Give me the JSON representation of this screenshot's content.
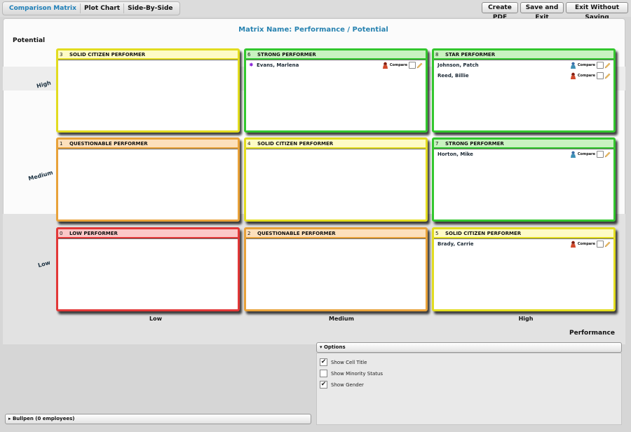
{
  "tabs": [
    "Comparison Matrix",
    "Plot Chart",
    "Side-By-Side"
  ],
  "toolbar": {
    "create_pdf": "Create PDF",
    "save_exit": "Save and Exit",
    "exit_no_save": "Exit Without Saving"
  },
  "matrix_name": "Matrix Name: Performance / Potential",
  "axis": {
    "y_title": "Potential",
    "x_title": "Performance",
    "rows": [
      "High",
      "Medium",
      "Low"
    ],
    "cols": [
      "Low",
      "Medium",
      "High"
    ]
  },
  "cells": [
    {
      "num": "3",
      "title": "SOLID CITIZEN PERFORMER",
      "employees": []
    },
    {
      "num": "6",
      "title": "STRONG PERFORMER",
      "employees": [
        {
          "name": "Evans, Marlena",
          "gender": "female",
          "bullet": "✸"
        }
      ]
    },
    {
      "num": "8",
      "title": "STAR PERFORMER",
      "employees": [
        {
          "name": "Johnson, Patch",
          "gender": "male"
        },
        {
          "name": "Reed, Billie",
          "gender": "female"
        }
      ]
    },
    {
      "num": "1",
      "title": "QUESTIONABLE PERFORMER",
      "employees": []
    },
    {
      "num": "4",
      "title": "SOLID CITIZEN PERFORMER",
      "employees": []
    },
    {
      "num": "7",
      "title": "STRONG PERFORMER",
      "employees": [
        {
          "name": "Horton, Mike",
          "gender": "male"
        }
      ]
    },
    {
      "num": "0",
      "title": "LOW PERFORMER",
      "employees": []
    },
    {
      "num": "2",
      "title": "QUESTIONABLE PERFORMER",
      "employees": []
    },
    {
      "num": "5",
      "title": "SOLID CITIZEN PERFORMER",
      "employees": [
        {
          "name": "Brady, Carrie",
          "gender": "female"
        }
      ]
    }
  ],
  "compare_label": "Compare",
  "options": {
    "header": "Options",
    "items": [
      {
        "label": "Show Cell Title",
        "checked": true
      },
      {
        "label": "Show Minority Status",
        "checked": false
      },
      {
        "label": "Show Gender",
        "checked": true
      }
    ]
  },
  "bullpen": "Bullpen (0 employees)",
  "colors": {
    "accent": "#2782b0",
    "yellow": "#e2dc20",
    "green": "#33c72e",
    "orange": "#e8a23a",
    "red": "#e23838"
  }
}
